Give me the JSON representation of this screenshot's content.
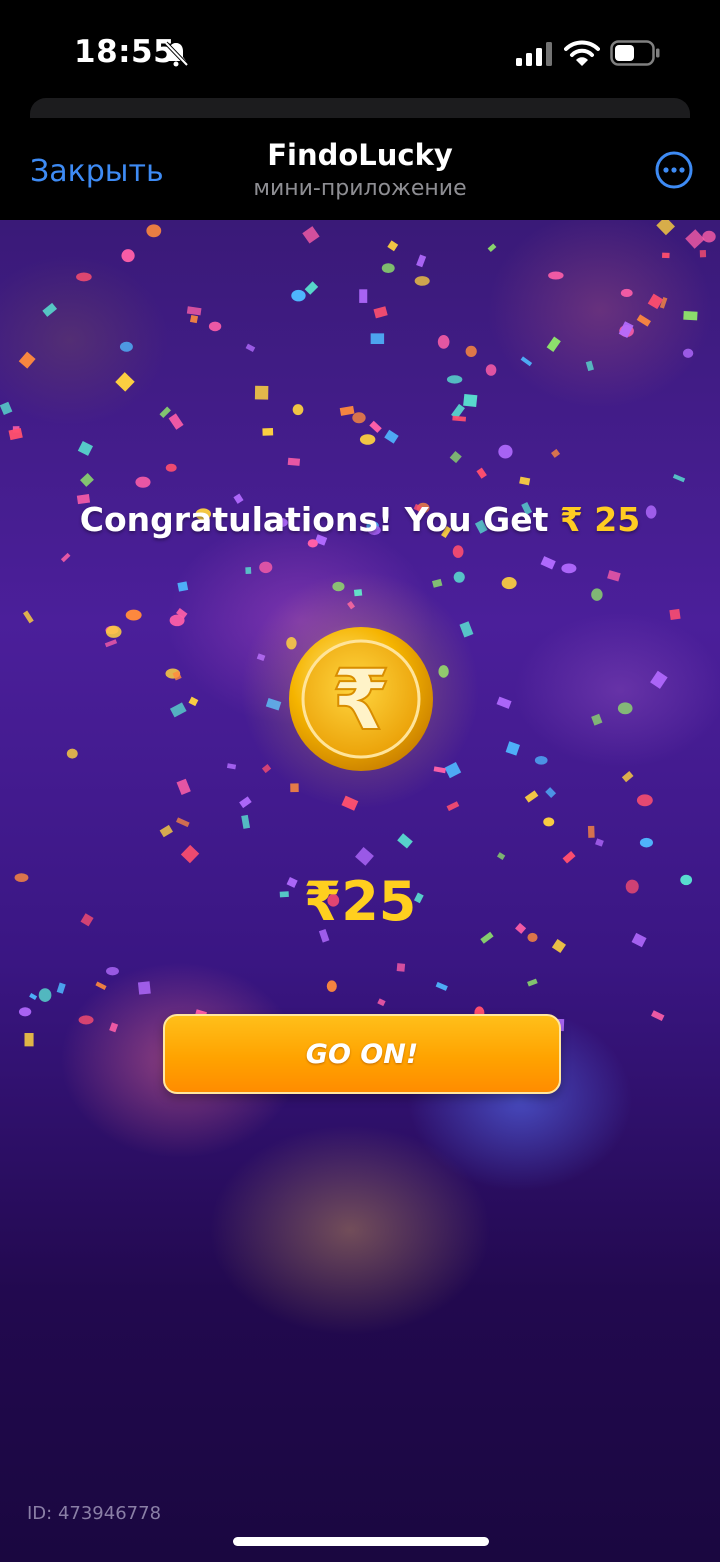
{
  "status_bar": {
    "time": "18:55",
    "icons": [
      "bell-slash-icon",
      "signal-icon",
      "wifi-icon",
      "battery-icon"
    ]
  },
  "header": {
    "close_label": "Закрыть",
    "title": "FindoLucky",
    "subtitle": "мини-приложение",
    "more_icon": "more-circle-icon"
  },
  "reward": {
    "congrats_prefix": "Congratulations! You Get",
    "congrats_amount": "₹ 25",
    "coin_icon": "rupee-coin-icon",
    "amount_display": "₹25",
    "button_label": "GO ON!"
  },
  "footer": {
    "user_id": "ID: 473946778"
  },
  "colors": {
    "accent_link": "#3e8bf4",
    "amount_gold": "#ffcc22",
    "button_orange": "#ffa300",
    "background_purple": "#4b1f9a"
  }
}
